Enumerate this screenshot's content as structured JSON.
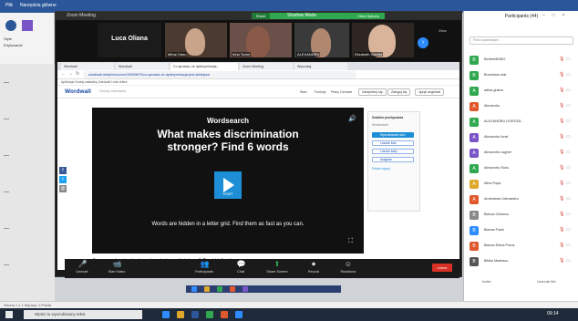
{
  "word": {
    "ribbon_file": "Plik",
    "ribbon_home": "Narzędzia główne",
    "side_labels": [
      "Style",
      "Edytowanie"
    ],
    "status": "Strona 1 z 1  Wyrazy: 0  Polski"
  },
  "taskbar": {
    "search_placeholder": "Wpisz tu wyszukiwany tekst",
    "time": "09:14"
  },
  "zoom": {
    "title": "Zoom Meeting",
    "share_tag": "Share",
    "shadow_banner": "Shadow Mode",
    "view_options": "View Options",
    "view_label": "View",
    "tiles": [
      {
        "name": "Luca Oliana",
        "kind": "name-only"
      },
      {
        "name": "Mihai Olaru",
        "kind": "video"
      },
      {
        "name": "Irina Tudor",
        "kind": "video"
      },
      {
        "name": "ALEXANDRU",
        "kind": "video"
      },
      {
        "name": "Elizabeth Gavrila",
        "kind": "video"
      }
    ],
    "controls": [
      {
        "label": "Unmute",
        "icon": "🎤"
      },
      {
        "label": "Start Video",
        "icon": "📹"
      },
      {
        "label": "Participants",
        "icon": "👥"
      },
      {
        "label": "Chat",
        "icon": "💬"
      },
      {
        "label": "Share Screen",
        "icon": "⬆"
      },
      {
        "label": "Record",
        "icon": "⏺"
      },
      {
        "label": "Reactions",
        "icon": "☺"
      }
    ],
    "end_label": "Leave"
  },
  "browser": {
    "tabs": [
      "Wordwall",
      "Wordwall",
      "Co sprawia, że dyskryminacja...",
      "Zoom Meeting",
      "Wyszukaj"
    ],
    "url": "wordwall.net/pl/resource/15399870/co-sprawia-ze-dyskryminacja-jest-silniejsza",
    "bookmarks": "Aplikacje   Dodaj zakładkę   Zakładki   Lista lektur"
  },
  "wordwall": {
    "logo": "Wordwall",
    "search": "Szukaj materiałów",
    "nav": [
      "Start",
      "Funkcje",
      "Plany Cenowe"
    ],
    "btn_signup": "Zarejestruj się",
    "btn_login": "Zaloguj się",
    "btn_lang": "Język angielski",
    "game_kicker": "Wordsearch",
    "game_title_1": "What makes discrimination",
    "game_title_2": "stronger? Find 6 words",
    "start_label": "START",
    "game_desc": "Words are hidden in a letter grid. Find them as fast as you can.",
    "caption": "Co sprawia, że dyskryminacja jest silniejsza? Znajdź 6 słów",
    "share_btn": "Udostępnij",
    "side_title": "Szablon przełączania",
    "side_sub": "Wordsearch",
    "side_options": [
      "Wyszukiwanie słów",
      "Losowe koło",
      "Losowe karty",
      "Anagram"
    ],
    "side_more": "Pokaż więcej"
  },
  "participants": {
    "title": "Participants (44)",
    "search_placeholder": "Find a participant",
    "list": [
      {
        "name": "BerbertBOBO",
        "color": "#2fa84f"
      },
      {
        "name": "Bronisiaru elat",
        "color": "#2fa84f"
      },
      {
        "name": "adina ghiera",
        "color": "#2fa84f"
      },
      {
        "name": "Alexandru",
        "color": "#e0582b"
      },
      {
        "name": "ALEXANDRU DORCEA",
        "color": "#2fa84f"
      },
      {
        "name": "Alexandru Ionel",
        "color": "#7a55c7"
      },
      {
        "name": "Alexandru Lagher",
        "color": "#7a55c7"
      },
      {
        "name": "Alexandru Stolu",
        "color": "#2fa84f"
      },
      {
        "name": "Alina Popa",
        "color": "#e0a82b"
      },
      {
        "name": "Ambrolearn Alexandra",
        "color": "#e0582b"
      },
      {
        "name": "Bianca Ciobanu",
        "color": "#888888"
      },
      {
        "name": "Bianca Florin",
        "color": "#2d8cff"
      },
      {
        "name": "Bianca Elena Preus",
        "color": "#e0582b"
      },
      {
        "name": "Bildisi Madescu",
        "color": "#555555"
      }
    ],
    "invite": "Invite",
    "mute_all": "Unmute Me"
  }
}
